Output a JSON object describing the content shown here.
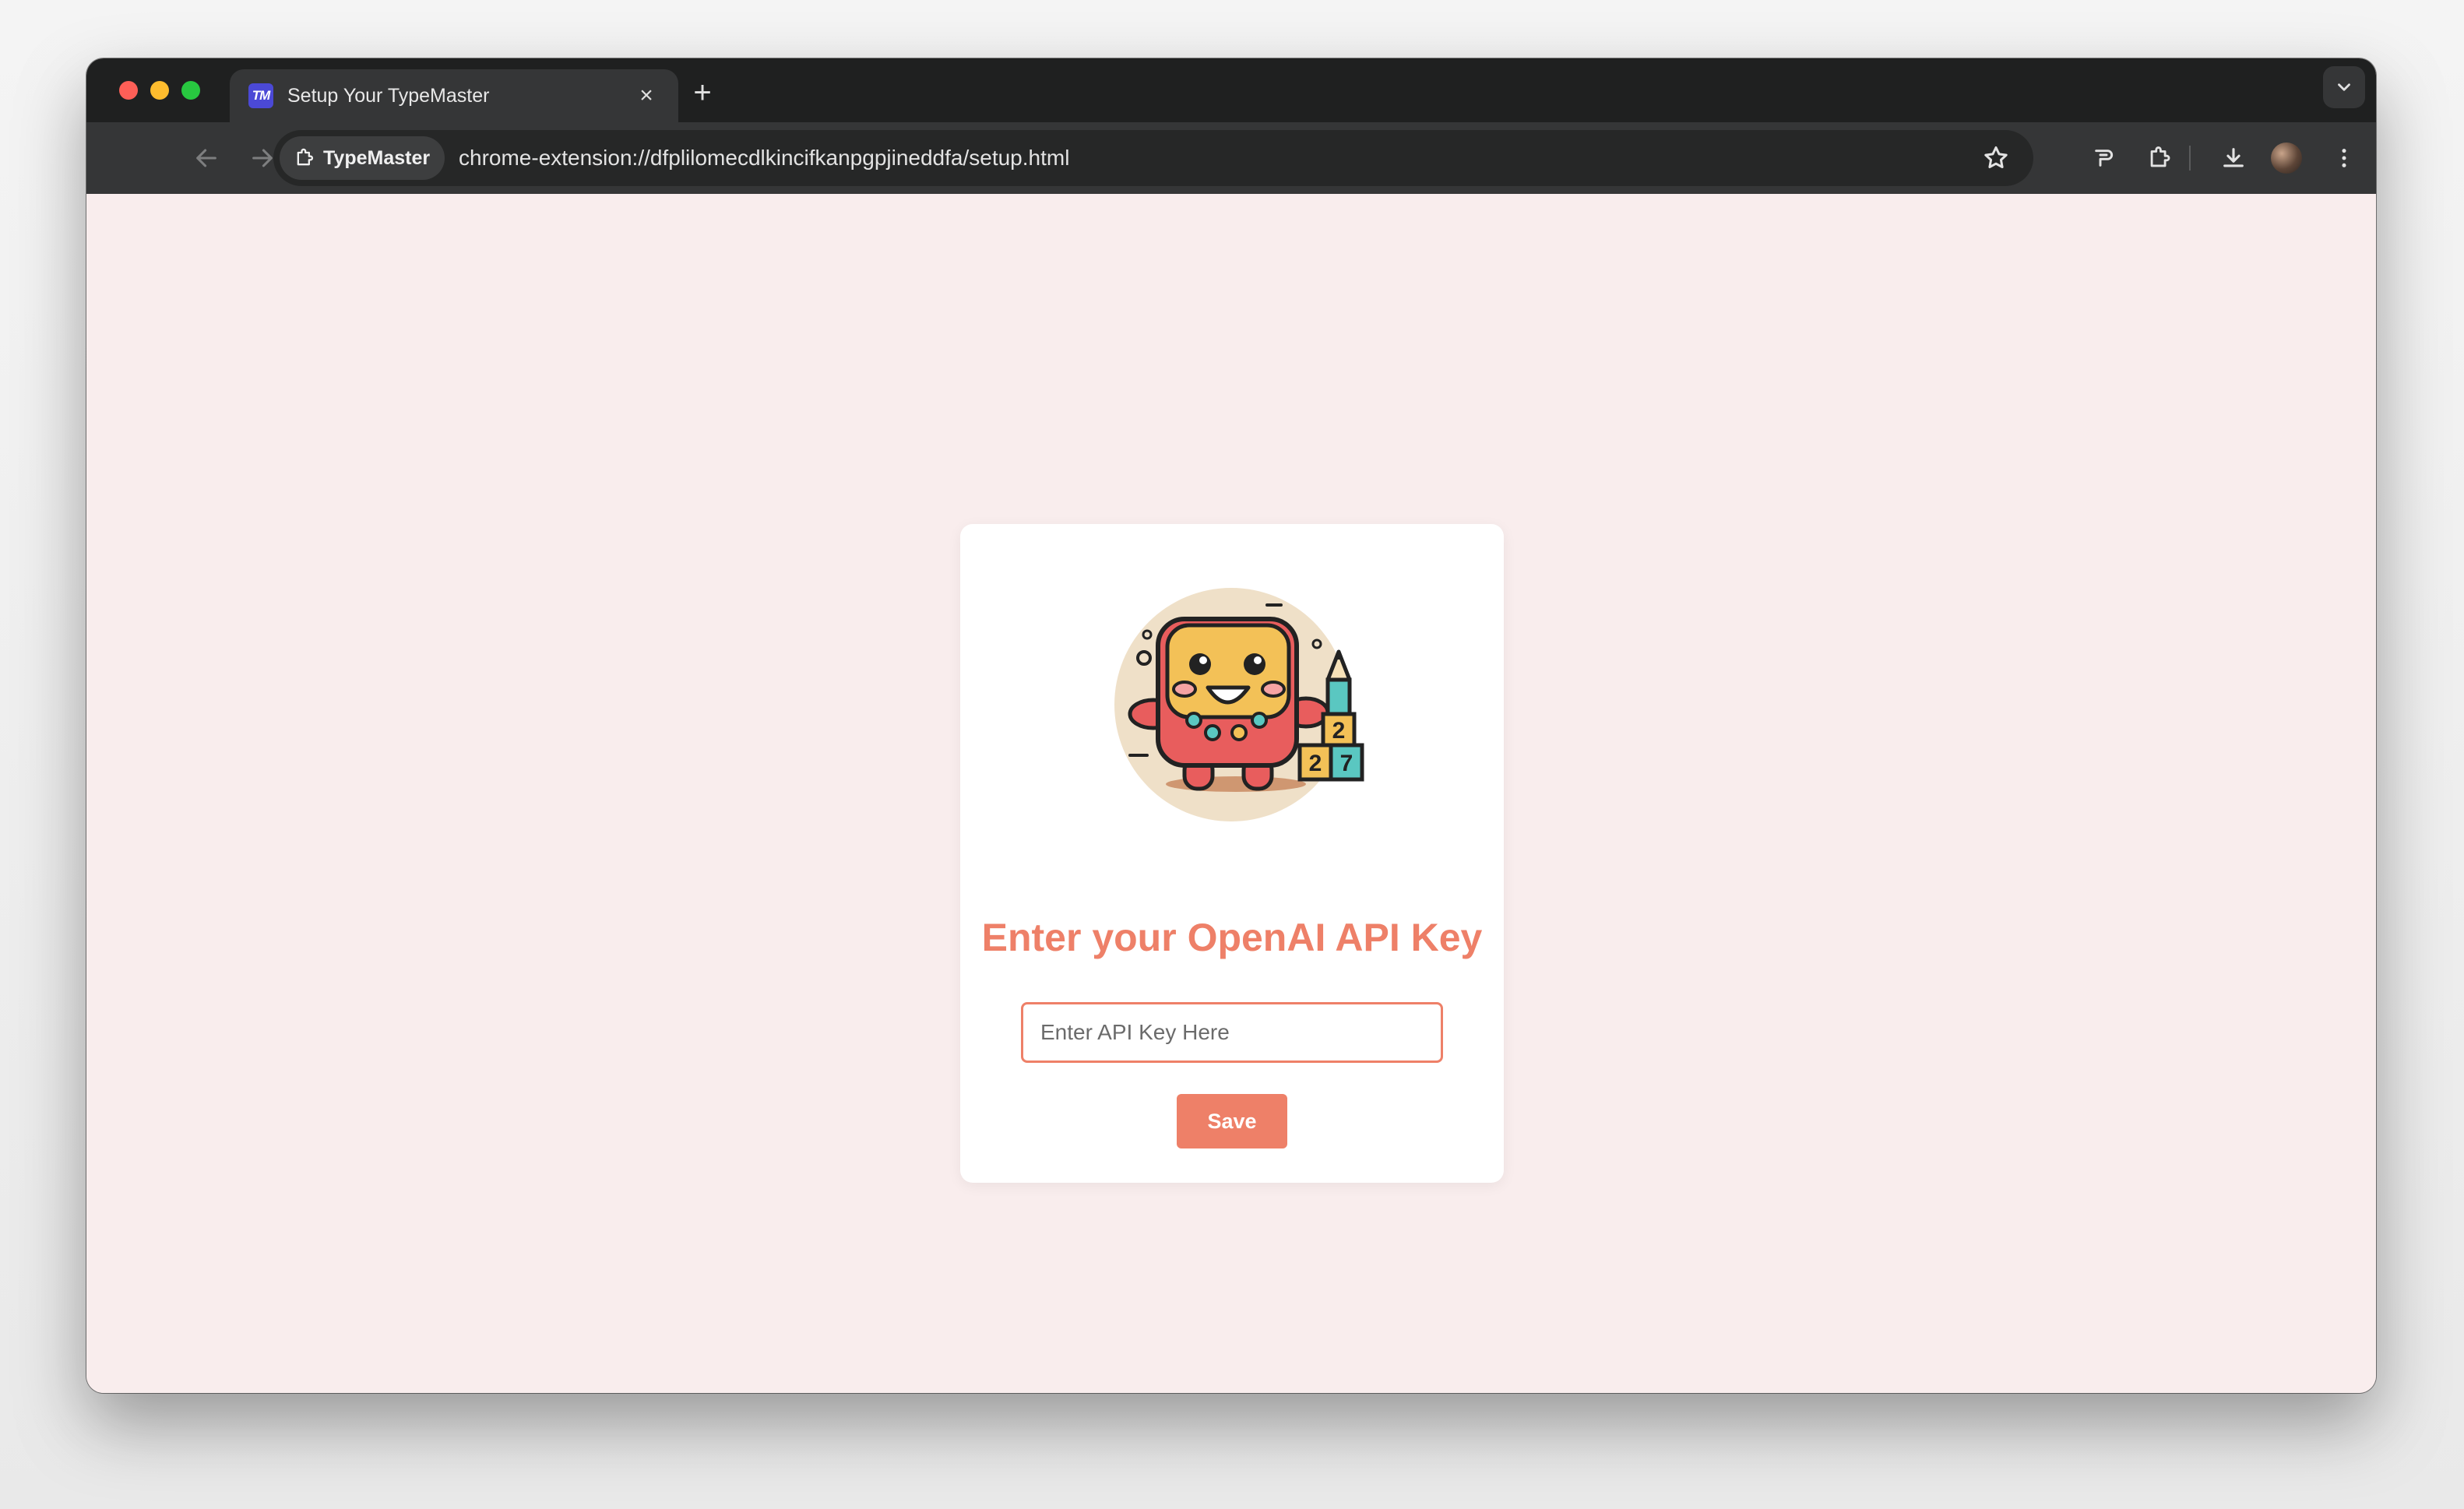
{
  "browser": {
    "tab": {
      "favicon_text": "TM",
      "title": "Setup Your TypeMaster",
      "close_glyph": "×"
    },
    "new_tab_glyph": "+",
    "site_chip_label": "TypeMaster",
    "url": "chrome-extension://dfplilomecdlkincifkanpgpjineddfa/setup.html",
    "icons": [
      "back-icon",
      "forward-icon",
      "reload-icon",
      "extension-icon",
      "star-icon",
      "reading-mode-icon",
      "extensions-puzzle-icon",
      "download-icon",
      "profile-avatar",
      "more-menu-icon",
      "tab-search-icon"
    ]
  },
  "setup": {
    "heading": "Enter your OpenAI API Key",
    "input_placeholder": "Enter API Key Here",
    "input_value": "",
    "save_label": "Save"
  },
  "colors": {
    "accent": "#ee8068",
    "page_background": "#f9eded",
    "card_background": "#ffffff",
    "chrome_dark": "#1f2020",
    "toolbar": "#353637"
  }
}
